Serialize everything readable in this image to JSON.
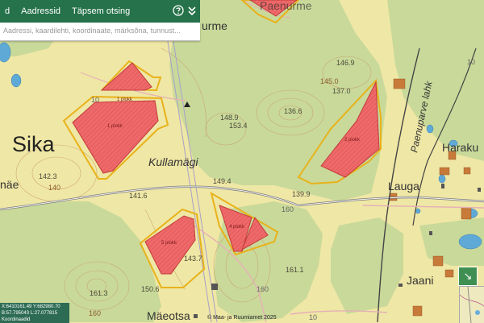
{
  "header": {
    "tabs": [
      {
        "label": "d"
      },
      {
        "label": "Aadressid"
      },
      {
        "label": "Täpsem otsing"
      }
    ],
    "icons": [
      "help-icon",
      "chevron-double-down-icon"
    ]
  },
  "search": {
    "placeholder": "Aadressi, kaardilehti, koordinaate, märksõna, tunnust..."
  },
  "map": {
    "places": {
      "sika": "Sika",
      "kullamagi": "Kullamägi",
      "lauga": "Lauga",
      "haraku": "Haraku",
      "jaani": "Jaani",
      "maeotsa": "Mäeotsa",
      "paenurme_top": "Paenurme",
      "urme": "urme",
      "nae": "näe",
      "paenuparve_lahk": "Paenuparve lahk"
    },
    "elevations": [
      "146.9",
      "145.0",
      "137.0",
      "136.6",
      "148.9",
      "153.4",
      "142.3",
      "141.6",
      "149.4",
      "139.9",
      "143.7",
      "150.6",
      "161.3",
      "161.1",
      "160",
      "140"
    ],
    "road_numbers": [
      "10",
      "10",
      "10",
      "160",
      "160"
    ],
    "plot_labels": [
      "1 plokk",
      "2 plokk",
      "5 plokk",
      "4 plokk",
      "1 plokk"
    ],
    "colors": {
      "field": "#efe7a5",
      "forest": "#c9d99a",
      "plot_fill": "#f0696a",
      "plot_outline": "#e8b21a",
      "water": "#5fa9d6",
      "building": "#c87a3a"
    }
  },
  "coords": {
    "line1": "X:6410161.49 Y:682980.70",
    "line2": "B:57.795043 L:27.077815",
    "line3": "Koordinaadid"
  },
  "attribution": "© Maa- ja Ruumiamet 2025",
  "controls": {
    "expand_symbol": "↘"
  }
}
